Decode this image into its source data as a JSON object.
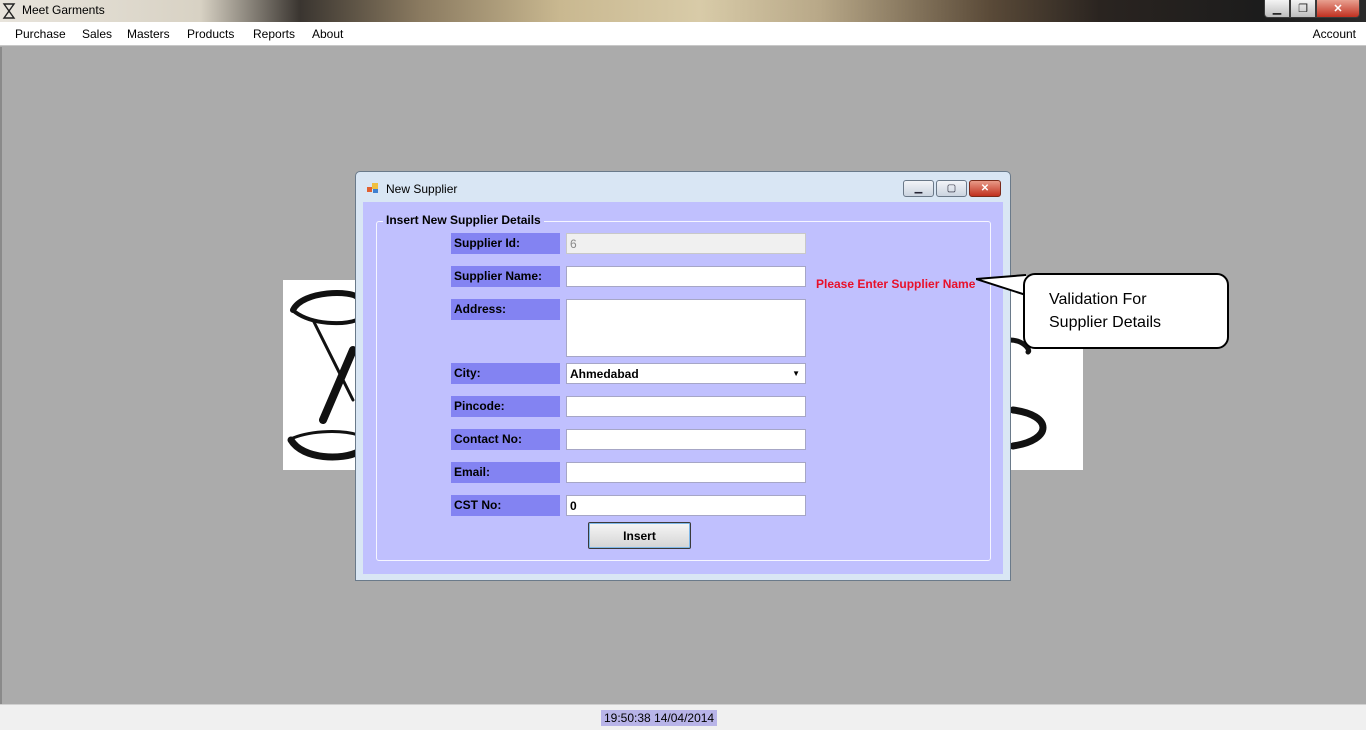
{
  "app": {
    "title": "Meet Garments"
  },
  "menu": {
    "items": [
      "Purchase",
      "Sales",
      "Masters",
      "Products",
      "Reports",
      "About"
    ],
    "right": "Account"
  },
  "status": {
    "datetime": "19:50:38 14/04/2014"
  },
  "dialog": {
    "title": "New Supplier",
    "group_title": "Insert New Supplier Details",
    "fields": {
      "supplier_id": {
        "label": "Supplier Id:",
        "value": "6"
      },
      "supplier_name": {
        "label": "Supplier Name:",
        "value": ""
      },
      "address": {
        "label": "Address:",
        "value": ""
      },
      "city": {
        "label": "City:",
        "value": "Ahmedabad"
      },
      "pincode": {
        "label": "Pincode:",
        "value": ""
      },
      "contact_no": {
        "label": "Contact No:",
        "value": ""
      },
      "email": {
        "label": "Email:",
        "value": ""
      },
      "cst_no": {
        "label": "CST No:",
        "value": "0"
      }
    },
    "error": "Please Enter Supplier Name",
    "insert_label": "Insert"
  },
  "callout": {
    "line1": "Validation For",
    "line2": "Supplier Details"
  },
  "colors": {
    "label_bg": "#8383f2",
    "form_bg": "#c0c0fe",
    "error": "#e8102a",
    "desktop": "#ababab"
  },
  "icons": [
    "app-icon",
    "minimize-icon",
    "restore-icon",
    "close-icon",
    "dialog-app-icon",
    "dropdown-arrow-icon"
  ]
}
